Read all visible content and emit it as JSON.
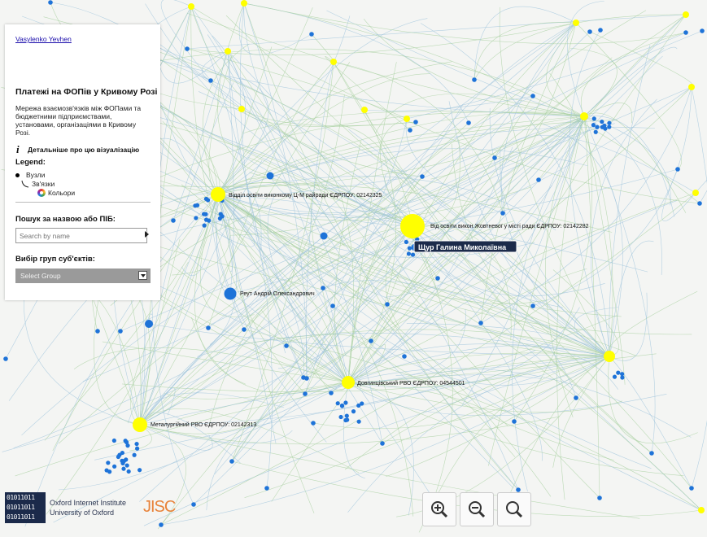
{
  "panel": {
    "author_link": "Vasylenko Yevhen",
    "title": "Платежі на ФОПів у Кривому Розі",
    "description": "Мережа взаємозв'язків між ФОПами та бюджетними підприємствами, установами, організаціями в Кривому Розі.",
    "info_link": "Детальніше про цю візуалізацію",
    "legend_title": "Legend:",
    "legend_nodes": "Вузли",
    "legend_edges": "Зв'язки",
    "legend_colors": "Кольори",
    "search_label": "Пошук за назвою або ПІБ:",
    "search_placeholder": "Search by name",
    "group_label": "Вибір груп суб'єктів:",
    "group_select_value": "Select Group"
  },
  "graph": {
    "colors": {
      "budget_node": "#ffff00",
      "person_node": "#1e73d8",
      "edge_green": "#a8d0a0",
      "edge_blue": "#9fc4dc",
      "highlight_label_bg": "#1b2a4a"
    },
    "labels": [
      {
        "text": "Відділ освіти виконкому Ц-М райради ЄДРПОУ:  02142325"
      },
      {
        "text": "Від освіти викон.Жовтневої у місті ради ЄДРПОУ:  02142282"
      },
      {
        "text": "Щур Галина Миколаївна"
      },
      {
        "text": "Реут Андрій Олександрович"
      },
      {
        "text": "Довгинцівський РВО ЄДРПОУ:  04544501"
      },
      {
        "text": "Металургійний РВО ЄДРПОУ:  02142313"
      }
    ]
  },
  "footer": {
    "oxford_line1": "Oxford Internet Institute",
    "oxford_line2": "University of Oxford",
    "oxford_logo_text": "01011011",
    "jisc_logo": "JISC"
  },
  "zoom_controls": [
    {
      "icon": "zoom-in-icon"
    },
    {
      "icon": "zoom-out-icon"
    },
    {
      "icon": "zoom-reset-icon"
    }
  ]
}
